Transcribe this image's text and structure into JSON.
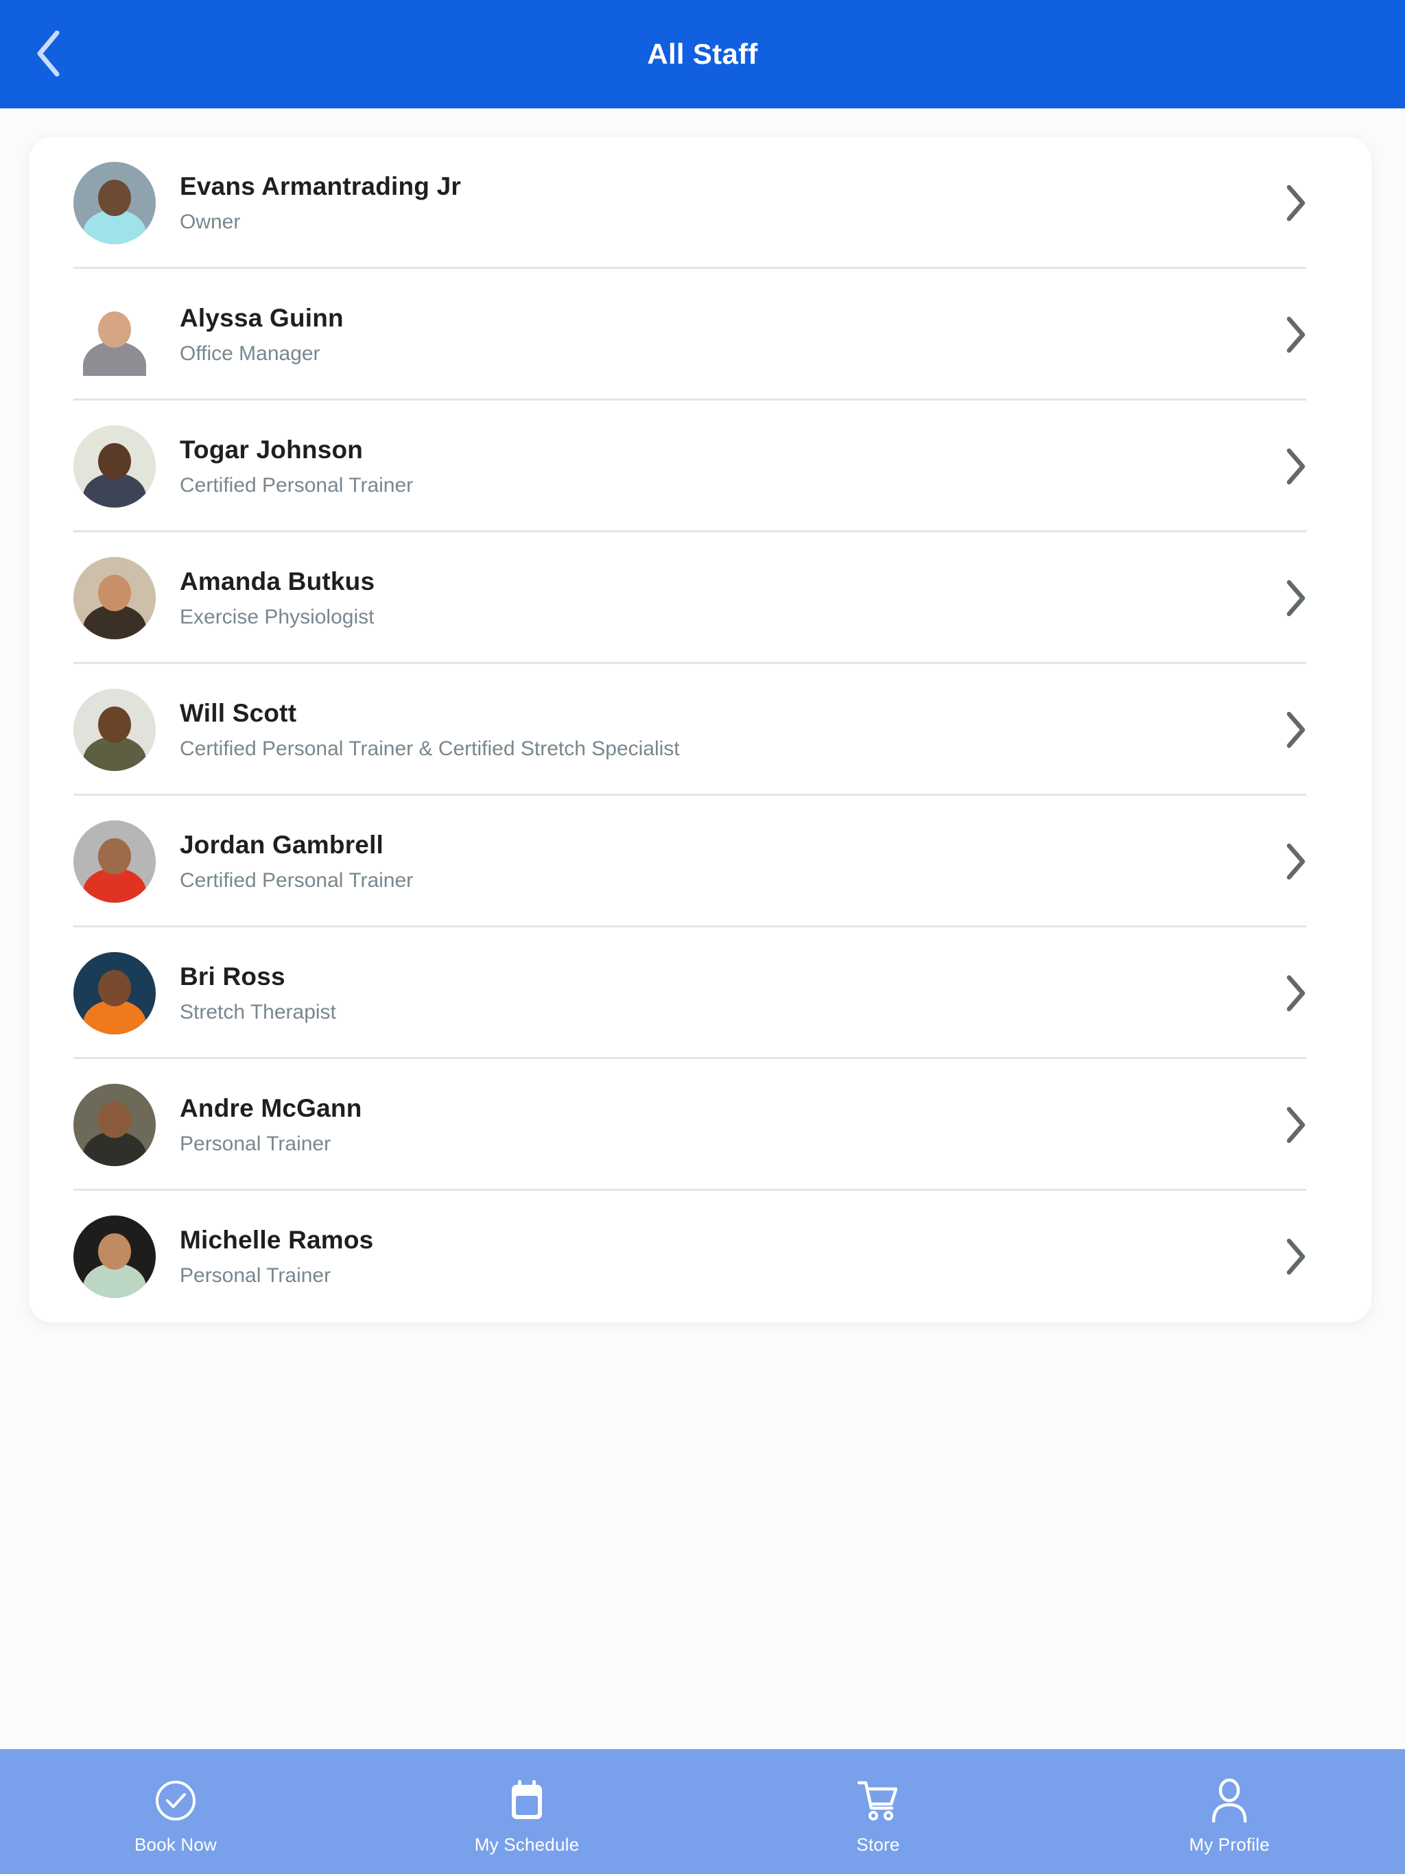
{
  "header": {
    "title": "All Staff",
    "back_icon": "chevron-left-icon",
    "background_color": "#1060e0"
  },
  "page": {
    "background_color": "#f7f7f8",
    "card_background_color": "#ffffff"
  },
  "staff_list": {
    "row_chevron_icon": "chevron-right-icon",
    "items": [
      {
        "name": "Evans Armantrading Jr",
        "title": "Owner",
        "avatar": {
          "alt": "Evans Armantrading Jr portrait",
          "bg": "#8ea3ad",
          "skin": "#6d4a33",
          "shirt": "#9fe3ea",
          "cropped": true
        }
      },
      {
        "name": "Alyssa Guinn",
        "title": "Office Manager",
        "avatar": {
          "alt": "Alyssa Guinn portrait",
          "bg": "#ffffff",
          "skin": "#d6a584",
          "shirt": "#8d8d93",
          "cropped": false
        }
      },
      {
        "name": "Togar Johnson",
        "title": "Certified Personal Trainer",
        "avatar": {
          "alt": "Togar Johnson portrait",
          "bg": "#e4e5da",
          "skin": "#5b3a26",
          "shirt": "#3d4456",
          "cropped": true
        }
      },
      {
        "name": "Amanda Butkus",
        "title": "Exercise Physiologist",
        "avatar": {
          "alt": "Amanda Butkus portrait",
          "bg": "#cdbfa9",
          "skin": "#c98f68",
          "shirt": "#3a3026",
          "cropped": true
        }
      },
      {
        "name": "Will Scott",
        "title": "Certified Personal Trainer & Certified Stretch Specialist",
        "avatar": {
          "alt": "Will Scott portrait",
          "bg": "#e2e2dc",
          "skin": "#6a4428",
          "shirt": "#5e5e43",
          "cropped": true
        }
      },
      {
        "name": "Jordan Gambrell",
        "title": "Certified Personal Trainer",
        "avatar": {
          "alt": "Jordan Gambrell portrait",
          "bg": "#b6b6b6",
          "skin": "#9d6a4a",
          "shirt": "#e03423",
          "cropped": true
        }
      },
      {
        "name": "Bri Ross",
        "title": "Stretch Therapist",
        "avatar": {
          "alt": "Bri Ross portrait",
          "bg": "#1b3c56",
          "skin": "#7a4a2e",
          "shirt": "#ef7a1e",
          "cropped": true
        }
      },
      {
        "name": "Andre McGann",
        "title": "Personal Trainer",
        "avatar": {
          "alt": "Andre McGann portrait",
          "bg": "#6d6a5a",
          "skin": "#8a5b3c",
          "shirt": "#30302b",
          "cropped": true
        }
      },
      {
        "name": "Michelle Ramos",
        "title": "Personal Trainer",
        "avatar": {
          "alt": "Michelle Ramos portrait",
          "bg": "#1e1d1c",
          "skin": "#c08a63",
          "shirt": "#bcd6c4",
          "cropped": true
        }
      }
    ]
  },
  "bottom_nav": {
    "background_color": "#79a0ea",
    "items": [
      {
        "label": "Book Now",
        "icon": "check-circle-icon"
      },
      {
        "label": "My Schedule",
        "icon": "calendar-icon"
      },
      {
        "label": "Store",
        "icon": "shopping-cart-icon"
      },
      {
        "label": "My Profile",
        "icon": "person-icon"
      }
    ]
  }
}
